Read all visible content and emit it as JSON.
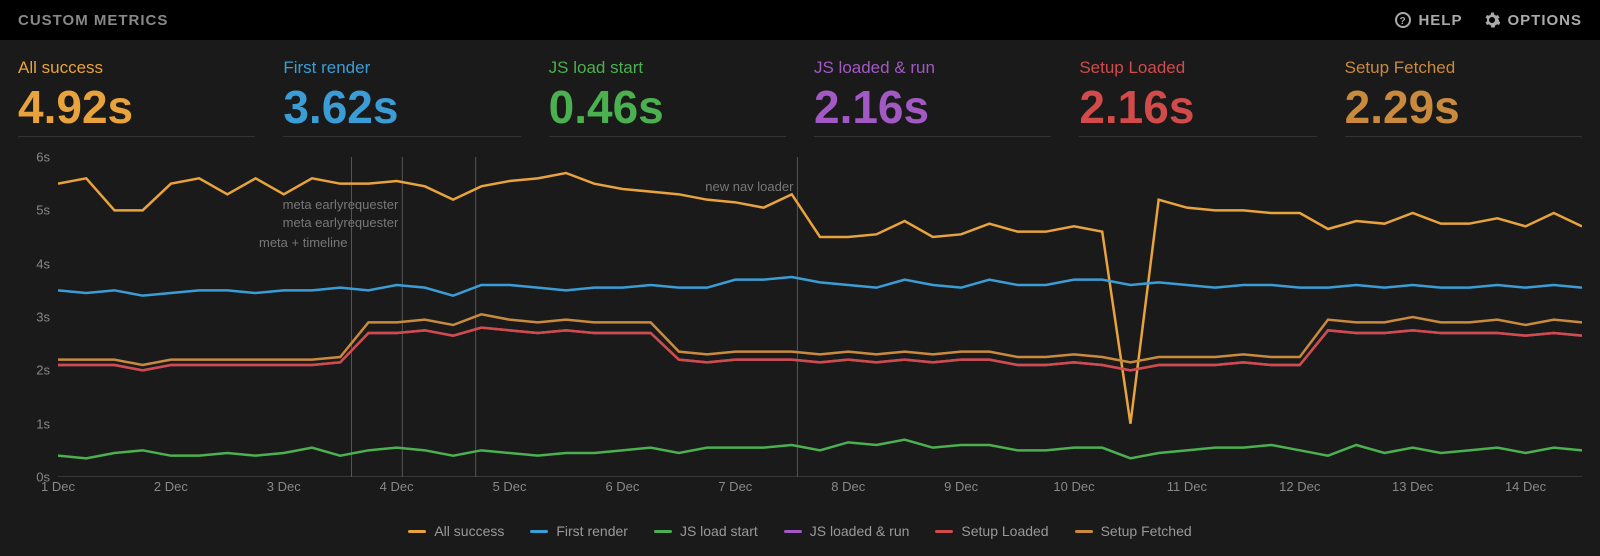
{
  "header": {
    "title": "CUSTOM METRICS",
    "help": "HELP",
    "options": "OPTIONS"
  },
  "metrics": [
    {
      "label": "All success",
      "value": "4.92s",
      "color": "orange"
    },
    {
      "label": "First render",
      "value": "3.62s",
      "color": "blue"
    },
    {
      "label": "JS load start",
      "value": "0.46s",
      "color": "green"
    },
    {
      "label": "JS loaded & run",
      "value": "2.16s",
      "color": "purple"
    },
    {
      "label": "Setup Loaded",
      "value": "2.16s",
      "color": "red"
    },
    {
      "label": "Setup Fetched",
      "value": "2.29s",
      "color": "brown"
    }
  ],
  "legend": [
    {
      "label": "All success",
      "color": "orange"
    },
    {
      "label": "First render",
      "color": "blue"
    },
    {
      "label": "JS load start",
      "color": "green"
    },
    {
      "label": "JS loaded & run",
      "color": "purple"
    },
    {
      "label": "Setup Loaded",
      "color": "red"
    },
    {
      "label": "Setup Fetched",
      "color": "brown"
    }
  ],
  "annotations": [
    {
      "label": "meta + timeline",
      "x": 3.6,
      "yOffset": 78
    },
    {
      "label": "meta earlyrequester",
      "x": 4.05,
      "yOffset": 40
    },
    {
      "label": "meta earlyrequester",
      "x": 4.05,
      "yOffset": 58
    },
    {
      "label": "new nav loader",
      "x": 7.55,
      "yOffset": 22
    }
  ],
  "vlines": [
    3.6,
    4.05,
    4.7,
    7.55
  ],
  "chart_data": {
    "type": "line",
    "xlabel": "",
    "ylabel": "",
    "ylim": [
      0,
      6
    ],
    "x_categories": [
      "1 Dec",
      "2 Dec",
      "3 Dec",
      "4 Dec",
      "5 Dec",
      "6 Dec",
      "7 Dec",
      "8 Dec",
      "9 Dec",
      "10 Dec",
      "11 Dec",
      "12 Dec",
      "13 Dec",
      "14 Dec"
    ],
    "y_ticks": [
      "0s",
      "1s",
      "2s",
      "3s",
      "4s",
      "5s",
      "6s"
    ],
    "x": [
      1.0,
      1.25,
      1.5,
      1.75,
      2.0,
      2.25,
      2.5,
      2.75,
      3.0,
      3.25,
      3.5,
      3.75,
      4.0,
      4.25,
      4.5,
      4.75,
      5.0,
      5.25,
      5.5,
      5.75,
      6.0,
      6.25,
      6.5,
      6.75,
      7.0,
      7.25,
      7.5,
      7.75,
      8.0,
      8.25,
      8.5,
      8.75,
      9.0,
      9.25,
      9.5,
      9.75,
      10.0,
      10.25,
      10.5,
      10.75,
      11.0,
      11.25,
      11.5,
      11.75,
      12.0,
      12.25,
      12.5,
      12.75,
      13.0,
      13.25,
      13.5,
      13.75,
      14.0,
      14.25,
      14.5
    ],
    "series": [
      {
        "name": "All success",
        "color": "#e8a33d",
        "values": [
          5.5,
          5.6,
          5.0,
          5.0,
          5.5,
          5.6,
          5.3,
          5.6,
          5.3,
          5.6,
          5.5,
          5.5,
          5.55,
          5.45,
          5.2,
          5.45,
          5.55,
          5.6,
          5.7,
          5.5,
          5.4,
          5.35,
          5.3,
          5.2,
          5.15,
          5.05,
          5.3,
          4.5,
          4.5,
          4.55,
          4.8,
          4.5,
          4.55,
          4.75,
          4.6,
          4.6,
          4.7,
          4.6,
          1.0,
          5.2,
          5.05,
          5.0,
          5.0,
          4.95,
          4.95,
          4.65,
          4.8,
          4.75,
          4.95,
          4.75,
          4.75,
          4.85,
          4.7,
          4.95,
          4.7
        ]
      },
      {
        "name": "First render",
        "color": "#3b9dd6",
        "values": [
          3.5,
          3.45,
          3.5,
          3.4,
          3.45,
          3.5,
          3.5,
          3.45,
          3.5,
          3.5,
          3.55,
          3.5,
          3.6,
          3.55,
          3.4,
          3.6,
          3.6,
          3.55,
          3.5,
          3.55,
          3.55,
          3.6,
          3.55,
          3.55,
          3.7,
          3.7,
          3.75,
          3.65,
          3.6,
          3.55,
          3.7,
          3.6,
          3.55,
          3.7,
          3.6,
          3.6,
          3.7,
          3.7,
          3.6,
          3.65,
          3.6,
          3.55,
          3.6,
          3.6,
          3.55,
          3.55,
          3.6,
          3.55,
          3.6,
          3.55,
          3.55,
          3.6,
          3.55,
          3.6,
          3.55
        ]
      },
      {
        "name": "JS load start",
        "color": "#4bb04f",
        "values": [
          0.4,
          0.35,
          0.45,
          0.5,
          0.4,
          0.4,
          0.45,
          0.4,
          0.45,
          0.55,
          0.4,
          0.5,
          0.55,
          0.5,
          0.4,
          0.5,
          0.45,
          0.4,
          0.45,
          0.45,
          0.5,
          0.55,
          0.45,
          0.55,
          0.55,
          0.55,
          0.6,
          0.5,
          0.65,
          0.6,
          0.7,
          0.55,
          0.6,
          0.6,
          0.5,
          0.5,
          0.55,
          0.55,
          0.35,
          0.45,
          0.5,
          0.55,
          0.55,
          0.6,
          0.5,
          0.4,
          0.6,
          0.45,
          0.55,
          0.45,
          0.5,
          0.55,
          0.45,
          0.55,
          0.5
        ]
      },
      {
        "name": "JS loaded & run",
        "color": "#a259c4",
        "values": [
          2.1,
          2.1,
          2.1,
          2.0,
          2.1,
          2.1,
          2.1,
          2.1,
          2.1,
          2.1,
          2.15,
          2.7,
          2.7,
          2.75,
          2.65,
          2.8,
          2.75,
          2.7,
          2.75,
          2.7,
          2.7,
          2.7,
          2.2,
          2.15,
          2.2,
          2.2,
          2.2,
          2.15,
          2.2,
          2.15,
          2.2,
          2.15,
          2.2,
          2.2,
          2.1,
          2.1,
          2.15,
          2.1,
          2.0,
          2.1,
          2.1,
          2.1,
          2.15,
          2.1,
          2.1,
          2.75,
          2.7,
          2.7,
          2.75,
          2.7,
          2.7,
          2.7,
          2.65,
          2.7,
          2.65
        ]
      },
      {
        "name": "Setup Loaded",
        "color": "#d14b4b",
        "values": [
          2.1,
          2.1,
          2.1,
          2.0,
          2.1,
          2.1,
          2.1,
          2.1,
          2.1,
          2.1,
          2.15,
          2.7,
          2.7,
          2.75,
          2.65,
          2.8,
          2.75,
          2.7,
          2.75,
          2.7,
          2.7,
          2.7,
          2.2,
          2.15,
          2.2,
          2.2,
          2.2,
          2.15,
          2.2,
          2.15,
          2.2,
          2.15,
          2.2,
          2.2,
          2.1,
          2.1,
          2.15,
          2.1,
          2.0,
          2.1,
          2.1,
          2.1,
          2.15,
          2.1,
          2.1,
          2.75,
          2.7,
          2.7,
          2.75,
          2.7,
          2.7,
          2.7,
          2.65,
          2.7,
          2.65
        ]
      },
      {
        "name": "Setup Fetched",
        "color": "#c98a3d",
        "values": [
          2.2,
          2.2,
          2.2,
          2.1,
          2.2,
          2.2,
          2.2,
          2.2,
          2.2,
          2.2,
          2.25,
          2.9,
          2.9,
          2.95,
          2.85,
          3.05,
          2.95,
          2.9,
          2.95,
          2.9,
          2.9,
          2.9,
          2.35,
          2.3,
          2.35,
          2.35,
          2.35,
          2.3,
          2.35,
          2.3,
          2.35,
          2.3,
          2.35,
          2.35,
          2.25,
          2.25,
          2.3,
          2.25,
          2.15,
          2.25,
          2.25,
          2.25,
          2.3,
          2.25,
          2.25,
          2.95,
          2.9,
          2.9,
          3.0,
          2.9,
          2.9,
          2.95,
          2.85,
          2.95,
          2.9
        ]
      }
    ]
  }
}
